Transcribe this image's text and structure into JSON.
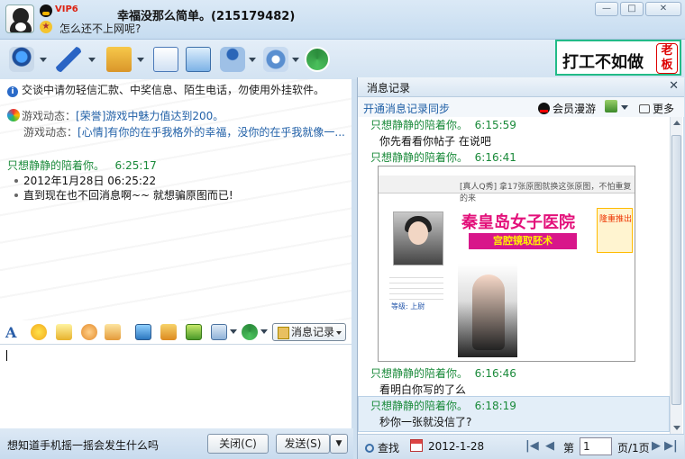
{
  "window": {
    "title": "幸福没那么简单。(215179482)",
    "vip_badge": "VIP6",
    "status_message": "怎么还不上网呢?",
    "min_glyph": "—",
    "restore_glyph": "□",
    "close_glyph": "✕"
  },
  "ad": {
    "text": "打工不如做",
    "boss": "老板"
  },
  "chat": {
    "safety_notice": "交谈中请勿轻信汇款、中奖信息、陌生电话，勿使用外挂软件。",
    "game_prefix": "游戏动态：",
    "game_line1": "[荣誉]游戏中魅力值达到200。",
    "game_line2": "[心情]有你的在乎我格外的幸福，没你的在乎我就像一...",
    "sender": "只想静静的陪着你。",
    "sender_time": "6:25:17",
    "date_line": "2012年1月28日  06:25:22",
    "message": "直到现在也不回消息啊~~  就想骗原图而已!"
  },
  "format_bar": {
    "history_label": "消息记录"
  },
  "bottom": {
    "tip": "想知道手机摇一摇会发生什么吗",
    "close_label": "关闭(C)",
    "send_label": "发送(S)",
    "send_arrow": "▼"
  },
  "history": {
    "title": "消息记录",
    "close_glyph": "✕",
    "sync_label": "开通消息记录同步",
    "member_label": "会员漫游",
    "more_label": "更多",
    "entries": [
      {
        "sender": "只想静静的陪着你。",
        "time": "6:15:59",
        "text": "你先看看你帖子 在说吧"
      },
      {
        "sender": "只想静静的陪着你。",
        "time": "6:16:41",
        "text": ""
      },
      {
        "sender": "只想静静的陪着你。",
        "time": "6:16:46",
        "text": "看明白你写的了么"
      },
      {
        "sender": "只想静静的陪着你。",
        "time": "6:18:19",
        "text": "秒你一张就没信了?"
      }
    ],
    "screenshot": {
      "bar_text": "[真人Q秀] 拿17张原图就换这张原图，不怕重复的来",
      "banner_title": "秦皇岛女子医院",
      "banner_sub": "宫腔镜取胚术",
      "banner_side": "隆重推出",
      "caption_label": "等级: 上尉"
    },
    "footer": {
      "find_label": "查找",
      "date": "2012-1-28",
      "first_glyph": "|◀",
      "prev_glyph": "◀",
      "page_prefix": "第",
      "page_value": "1",
      "page_total": "页/1页",
      "next_glyph": "▶",
      "last_glyph": "▶|"
    }
  }
}
